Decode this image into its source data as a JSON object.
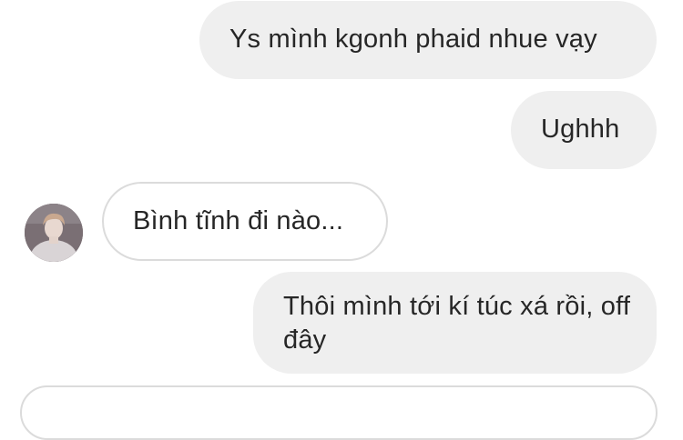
{
  "conversation": {
    "messages": [
      {
        "sender": "me",
        "text": "Ys mình kgonh phaid nhue vạy"
      },
      {
        "sender": "me",
        "text": "Ughhh"
      },
      {
        "sender": "other",
        "text": "Bình tĩnh đi nào..."
      },
      {
        "sender": "me",
        "text": "Thôi mình tới kí túc xá rồi, off đây"
      }
    ]
  },
  "colors": {
    "outgoing_bubble": "#efefef",
    "incoming_bubble": "#ffffff",
    "incoming_border": "#dbdbdb",
    "text": "#262626"
  }
}
